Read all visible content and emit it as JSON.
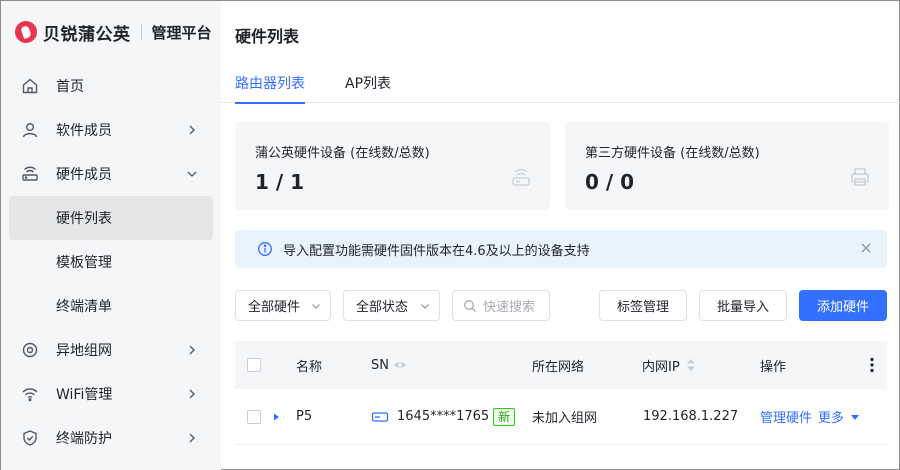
{
  "brand": {
    "name": "贝锐蒲公英",
    "subtitle": "管理平台"
  },
  "sidebar": {
    "items": [
      {
        "label": "首页",
        "icon": "home-icon"
      },
      {
        "label": "软件成员",
        "icon": "user-icon",
        "expanded": false
      },
      {
        "label": "硬件成员",
        "icon": "router-icon",
        "expanded": true
      },
      {
        "label": "硬件列表",
        "sub": true,
        "active": true
      },
      {
        "label": "模板管理",
        "sub": true
      },
      {
        "label": "终端清单",
        "sub": true
      },
      {
        "label": "异地组网",
        "icon": "network-icon",
        "expanded": false
      },
      {
        "label": "WiFi管理",
        "icon": "wifi-icon",
        "expanded": false
      },
      {
        "label": "终端防护",
        "icon": "shield-icon",
        "expanded": false
      }
    ]
  },
  "main": {
    "title": "硬件列表",
    "tabs": [
      {
        "label": "路由器列表",
        "active": true
      },
      {
        "label": "AP列表",
        "active": false
      }
    ],
    "cards": [
      {
        "label": "蒲公英硬件设备 (在线数/总数)",
        "value": "1 / 1",
        "icon": "router-outline-icon"
      },
      {
        "label": "第三方硬件设备 (在线数/总数)",
        "value": "0 / 0",
        "icon": "printer-icon"
      }
    ],
    "alert": {
      "text": "导入配置功能需硬件固件版本在4.6及以上的设备支持"
    },
    "filters": {
      "hardware": "全部硬件",
      "status": "全部状态",
      "search_placeholder": "快速搜索"
    },
    "buttons": {
      "tags": "标签管理",
      "import": "批量导入",
      "add": "添加硬件"
    },
    "table": {
      "columns": [
        "名称",
        "SN",
        "所在网络",
        "内网IP",
        "操作"
      ],
      "rows": [
        {
          "name": "P5",
          "sn": "1645****1765",
          "badge": "新",
          "network": "未加入组网",
          "ip": "192.168.1.227",
          "action_manage": "管理硬件",
          "action_more": "更多"
        }
      ]
    }
  },
  "colors": {
    "accent": "#3370ff",
    "brand": "#e8344e",
    "alert_bg": "#e8f3fd",
    "badge_green": "#34c724"
  }
}
